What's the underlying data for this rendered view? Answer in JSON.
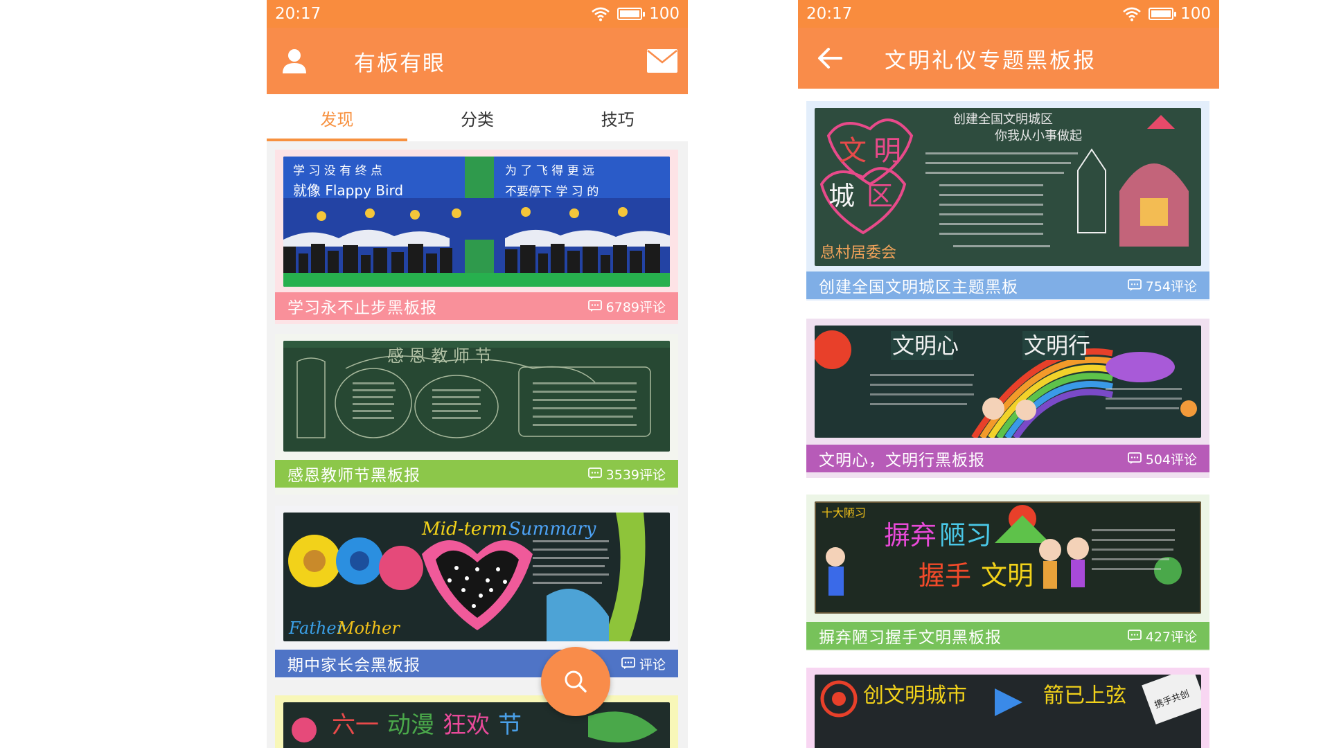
{
  "left_screen": {
    "status": {
      "time": "20:17",
      "battery": "100"
    },
    "app_bar": {
      "title": "有板有眼",
      "user_icon": "user-icon",
      "mail_icon": "mail-icon"
    },
    "tabs": [
      {
        "label": "发现",
        "active": true
      },
      {
        "label": "分类",
        "active": false
      },
      {
        "label": "技巧",
        "active": false
      }
    ],
    "cards": [
      {
        "title": "学习永不止步黑板报",
        "comments": "6789评论",
        "bar_color": "#f9909a",
        "bg_color": "#fde3e6",
        "image_text_1": "学习没有终点 就像Flappy Bird",
        "image_text_2": "为了飞得更远 不要停下学习的脚步"
      },
      {
        "title": "感恩教师节黑板报",
        "comments": "3539评论",
        "bar_color": "#8cc74a",
        "bg_color": "#f3f5ef",
        "image_text_1": "感恩教师节"
      },
      {
        "title": "期中家长会黑板报",
        "comments": "评论",
        "bar_color": "#4f74c6",
        "bg_color": "#f3f3f6",
        "image_text_1": "Mid-term Summary",
        "image_text_2": "Father AND Mother"
      },
      {
        "title": "",
        "comments": "",
        "bar_color": "#f6f28c",
        "bg_color": "#f8f7b8",
        "image_text_1": "六一动漫狂欢节"
      }
    ],
    "fab_icon": "search-icon"
  },
  "right_screen": {
    "status": {
      "time": "20:17",
      "battery": "100"
    },
    "app_bar": {
      "title": "文明礼仪专题黑板报",
      "back_icon": "back-arrow-icon"
    },
    "cards": [
      {
        "title": "创建全国文明城区主题黑板",
        "comments": "754评论",
        "bar_color": "#7faee6",
        "bg_color": "#e3eefb",
        "image_text_1": "创建全国文明城区 你我从小事做起",
        "image_text_2": "文明城区"
      },
      {
        "title": "文明心，文明行黑板报",
        "comments": "504评论",
        "bar_color": "#b75bb8",
        "bg_color": "#f0e0f0",
        "image_text_1": "文明心",
        "image_text_2": "文明行"
      },
      {
        "title": "摒弃陋习握手文明黑板报",
        "comments": "427评论",
        "bar_color": "#77c25a",
        "bg_color": "#ecf5e6",
        "image_text_1": "摒弃陋习",
        "image_text_2": "握手文明"
      },
      {
        "title": "",
        "comments": "",
        "bar_color": "#e68ad8",
        "bg_color": "#f8d6f2",
        "image_text_1": "创文明城市 箭已上弦",
        "image_text_2": "携手共创文明城市"
      }
    ]
  }
}
